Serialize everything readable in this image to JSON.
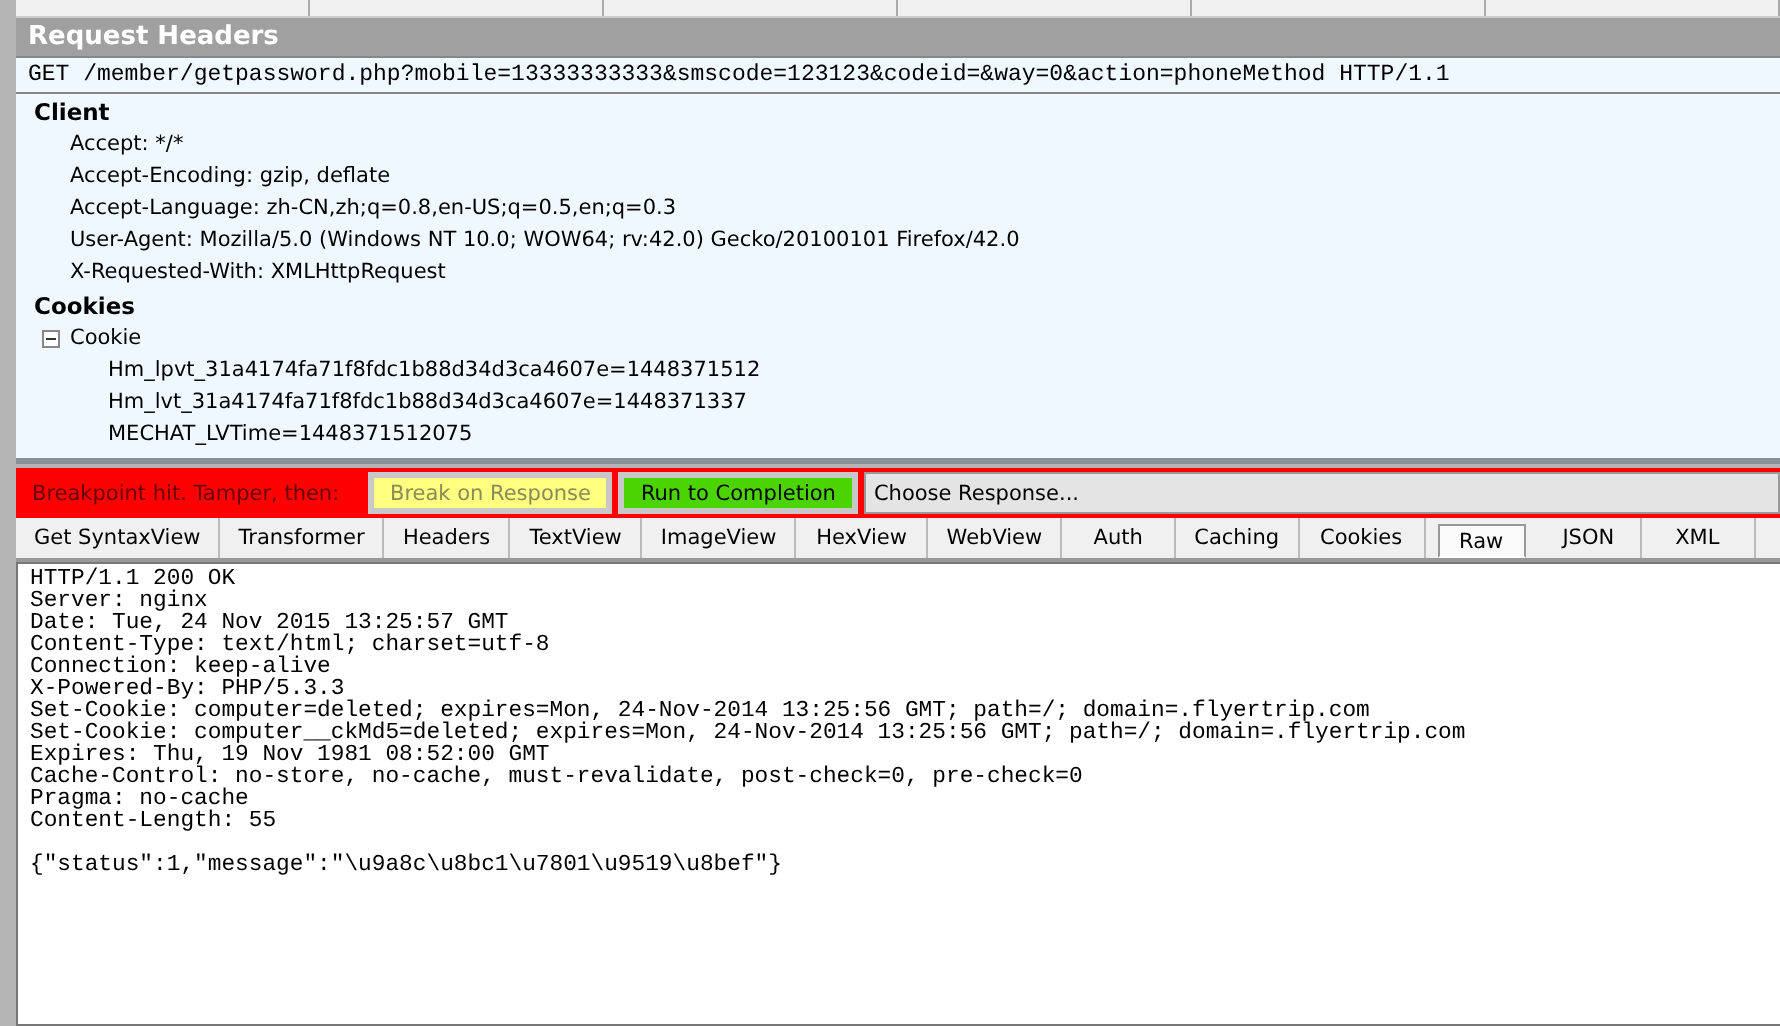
{
  "request_headers": {
    "title": "Request Headers",
    "request_line": "GET /member/getpassword.php?mobile=13333333333&smscode=123123&codeid=&way=0&action=phoneMethod HTTP/1.1",
    "groups": [
      {
        "name": "Client",
        "items": [
          {
            "text": "Accept: */*"
          },
          {
            "text": "Accept-Encoding: gzip, deflate"
          },
          {
            "text": "Accept-Language: zh-CN,zh;q=0.8,en-US;q=0.5,en;q=0.3"
          },
          {
            "text": "User-Agent: Mozilla/5.0 (Windows NT 10.0; WOW64; rv:42.0) Gecko/20100101 Firefox/42.0"
          },
          {
            "text": "X-Requested-With: XMLHttpRequest"
          }
        ]
      },
      {
        "name": "Cookies",
        "items": [
          {
            "text": "Cookie",
            "expanded": true,
            "children": [
              {
                "text": "Hm_lpvt_31a4174fa71f8fdc1b88d34d3ca4607e=1448371512"
              },
              {
                "text": "Hm_lvt_31a4174fa71f8fdc1b88d34d3ca4607e=1448371337"
              },
              {
                "text": "MECHAT_LVTime=1448371512075"
              }
            ]
          }
        ]
      }
    ]
  },
  "breakpoint_bar": {
    "message": "Breakpoint hit. Tamper, then:",
    "controls": [
      {
        "kind": "button",
        "label": "Break on Response",
        "color": "#ffff80",
        "disabled": true
      },
      {
        "kind": "button",
        "label": "Run to Completion",
        "color": "#4cd400",
        "disabled": false
      },
      {
        "kind": "dropdown",
        "label": "Choose Response..."
      }
    ]
  },
  "response_tabs": [
    {
      "label": "Get SyntaxView",
      "selected": false
    },
    {
      "label": "Transformer",
      "selected": false
    },
    {
      "label": "Headers",
      "selected": false
    },
    {
      "label": "TextView",
      "selected": false
    },
    {
      "label": "ImageView",
      "selected": false
    },
    {
      "label": "HexView",
      "selected": false
    },
    {
      "label": "WebView",
      "selected": false
    },
    {
      "label": "Auth",
      "selected": false
    },
    {
      "label": "Caching",
      "selected": false
    },
    {
      "label": "Cookies",
      "selected": false
    },
    {
      "label": "Raw",
      "selected": true
    },
    {
      "label": "JSON",
      "selected": false
    },
    {
      "label": "XML",
      "selected": false
    }
  ],
  "raw_response": {
    "header_lines": [
      "HTTP/1.1 200 OK",
      "Server: nginx",
      "Date: Tue, 24 Nov 2015 13:25:57 GMT",
      "Content-Type: text/html; charset=utf-8",
      "Connection: keep-alive",
      "X-Powered-By: PHP/5.3.3",
      "Set-Cookie: computer=deleted; expires=Mon, 24-Nov-2014 13:25:56 GMT; path=/; domain=.flyertrip.com",
      "Set-Cookie: computer__ckMd5=deleted; expires=Mon, 24-Nov-2014 13:25:56 GMT; path=/; domain=.flyertrip.com",
      "Expires: Thu, 19 Nov 1981 08:52:00 GMT",
      "Cache-Control: no-store, no-cache, must-revalidate, post-check=0, pre-check=0",
      "Pragma: no-cache",
      "Content-Length: 55"
    ],
    "body": "{\"status\":1,\"message\":\"\\u9a8c\\u8bc1\\u7801\\u9519\\u8bef\"}"
  }
}
